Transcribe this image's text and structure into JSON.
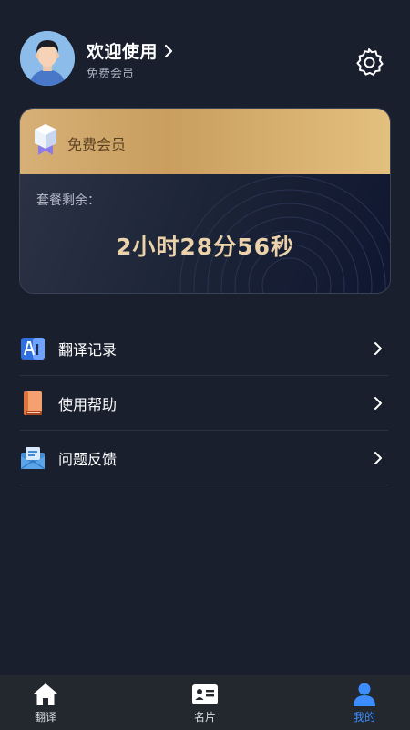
{
  "header": {
    "user_name": "欢迎使用",
    "user_level": "免费会员"
  },
  "card": {
    "level": "免费会员",
    "remain_label": "套餐剩余：",
    "remain_time": "2小时28分56秒"
  },
  "menu": {
    "items": [
      {
        "label": "翻译记录",
        "icon": "translate-record-icon"
      },
      {
        "label": "使用帮助",
        "icon": "help-book-icon"
      },
      {
        "label": "问题反馈",
        "icon": "feedback-mail-icon"
      }
    ]
  },
  "tabbar": {
    "tabs": [
      {
        "label": "翻译",
        "icon": "home-icon"
      },
      {
        "label": "名片",
        "icon": "card-icon"
      },
      {
        "label": "我的",
        "icon": "user-icon",
        "active": true
      }
    ]
  },
  "colors": {
    "background": "#1a1f2e",
    "accent": "#3d8dff",
    "gold": "#d6b077",
    "time_text": "#ecd2ab"
  }
}
